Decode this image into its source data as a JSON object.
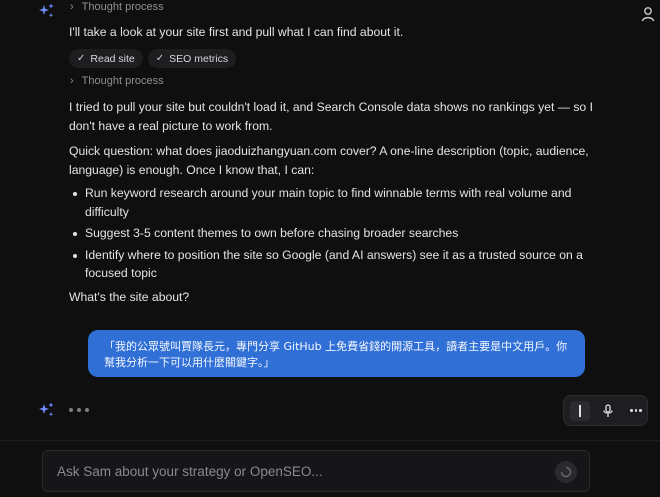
{
  "thought_process_1": {
    "label": "Thought process"
  },
  "intro_text": "I'll take a look at your site first and pull what I can find about it.",
  "tool_chips": [
    {
      "label": "Read site",
      "icon": "check-icon"
    },
    {
      "label": "SEO metrics",
      "icon": "check-icon"
    }
  ],
  "thought_process_2": {
    "label": "Thought process"
  },
  "message": {
    "para1": "I tried to pull your site but couldn't load it, and Search Console data shows no rankings yet — so I don't have a real picture to work from.",
    "para2": "Quick question: what does jiaoduizhangyuan.com cover? A one-line description (topic, audience, language) is enough. Once I know that, I can:",
    "bullets": [
      "Run keyword research around your main topic to find winnable terms with real volume and difficulty",
      "Suggest 3-5 content themes to own before chasing broader searches",
      "Identify where to position the site so Google (and AI answers) see it as a trusted source on a focused topic"
    ],
    "closing": "What's the site about?"
  },
  "user_message": "「我的公眾號叫賈隊長元，專門分享 GitHub 上免費省錢的開源工具，讀者主要是中文用戶。你幫我分析一下可以用什麼關鍵字。」",
  "composer": {
    "placeholder": "Ask Sam about your strategy or OpenSEO..."
  },
  "colors": {
    "background": "#0f0f10",
    "user_bubble": "#2f6fd6",
    "assistant_icon": "#6f8cff"
  }
}
